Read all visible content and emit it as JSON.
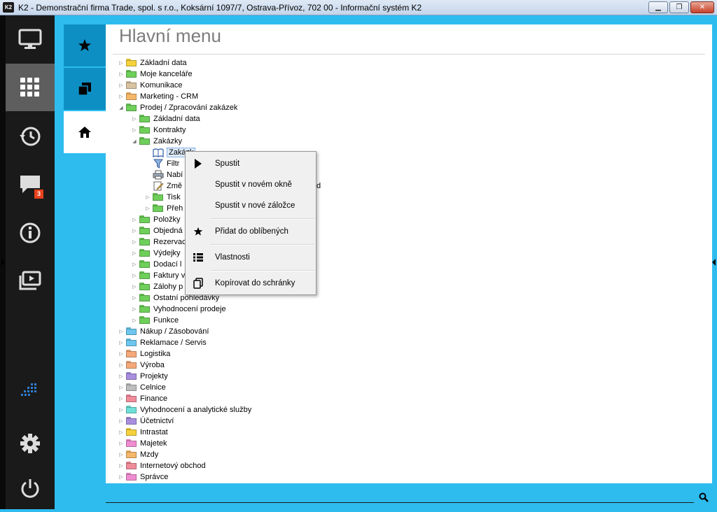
{
  "window": {
    "app_icon_text": "K2",
    "title": "K2 - Demonstrační firma Trade, spol. s r.o., Koksární 1097/7, Ostrava-Přívoz, 702 00 - Informační systém K2",
    "min": "▁",
    "max": "❐",
    "close": "✕"
  },
  "rail": {
    "badge_count": "3"
  },
  "page": {
    "title": "Hlavní menu"
  },
  "tree": [
    {
      "label": "Základní data",
      "level": 0,
      "exp": "▷",
      "color": "#f5d23c"
    },
    {
      "label": "Moje kanceláře",
      "level": 0,
      "exp": "▷",
      "color": "#6ecf5a"
    },
    {
      "label": "Komunikace",
      "level": 0,
      "exp": "▷",
      "color": "#d7c3a1"
    },
    {
      "label": "Marketing - CRM",
      "level": 0,
      "exp": "▷",
      "color": "#f5b76a"
    },
    {
      "label": "Prodej / Zpracování zakázek",
      "level": 0,
      "exp": "◢",
      "color": "#6ecf5a"
    },
    {
      "label": "Základní data",
      "level": 1,
      "exp": "▷",
      "color": "#6ecf5a"
    },
    {
      "label": "Kontrakty",
      "level": 1,
      "exp": "▷",
      "color": "#6ecf5a"
    },
    {
      "label": "Zakázky",
      "level": 1,
      "exp": "◢",
      "color": "#6ecf5a"
    },
    {
      "label": "Zakázk",
      "level": 2,
      "exp": "",
      "icon": "book",
      "selected": true
    },
    {
      "label": "Filtr",
      "level": 2,
      "exp": "",
      "icon": "filter"
    },
    {
      "label": "Nabí",
      "level": 2,
      "exp": "",
      "icon": "printer"
    },
    {
      "label": "Změ",
      "level": 2,
      "exp": "",
      "icon": "edit",
      "suffix": "d"
    },
    {
      "label": "Tisk",
      "level": 2,
      "exp": "▷",
      "color": "#6ecf5a"
    },
    {
      "label": "Přeh",
      "level": 2,
      "exp": "▷",
      "color": "#6ecf5a"
    },
    {
      "label": "Položky",
      "level": 1,
      "exp": "▷",
      "color": "#6ecf5a"
    },
    {
      "label": "Objedná",
      "level": 1,
      "exp": "▷",
      "color": "#6ecf5a"
    },
    {
      "label": "Rezervac",
      "level": 1,
      "exp": "▷",
      "color": "#6ecf5a"
    },
    {
      "label": "Výdejky",
      "level": 1,
      "exp": "▷",
      "color": "#6ecf5a"
    },
    {
      "label": "Dodací l",
      "level": 1,
      "exp": "▷",
      "color": "#6ecf5a"
    },
    {
      "label": "Faktury v",
      "level": 1,
      "exp": "▷",
      "color": "#6ecf5a"
    },
    {
      "label": "Zálohy p",
      "level": 1,
      "exp": "▷",
      "color": "#6ecf5a"
    },
    {
      "label": "Ostatní pohledávky",
      "level": 1,
      "exp": "▷",
      "color": "#6ecf5a"
    },
    {
      "label": "Vyhodnocení prodeje",
      "level": 1,
      "exp": "▷",
      "color": "#6ecf5a"
    },
    {
      "label": "Funkce",
      "level": 1,
      "exp": "▷",
      "color": "#6ecf5a"
    },
    {
      "label": "Nákup / Zásobování",
      "level": 0,
      "exp": "▷",
      "color": "#6cc6ee"
    },
    {
      "label": "Reklamace / Servis",
      "level": 0,
      "exp": "▷",
      "color": "#6cc6ee"
    },
    {
      "label": "Logistika",
      "level": 0,
      "exp": "▷",
      "color": "#f5a97a"
    },
    {
      "label": "Výroba",
      "level": 0,
      "exp": "▷",
      "color": "#f5a97a"
    },
    {
      "label": "Projekty",
      "level": 0,
      "exp": "▷",
      "color": "#a98ee0"
    },
    {
      "label": "Celnice",
      "level": 0,
      "exp": "▷",
      "color": "#bdbdbd"
    },
    {
      "label": "Finance",
      "level": 0,
      "exp": "▷",
      "color": "#f08c9a"
    },
    {
      "label": "Vyhodnocení a analytické služby",
      "level": 0,
      "exp": "▷",
      "color": "#6ee0d8"
    },
    {
      "label": "Účetnictví",
      "level": 0,
      "exp": "▷",
      "color": "#a98ee0"
    },
    {
      "label": "Intrastat",
      "level": 0,
      "exp": "▷",
      "color": "#f5d23c"
    },
    {
      "label": "Majetek",
      "level": 0,
      "exp": "▷",
      "color": "#f08cd0"
    },
    {
      "label": "Mzdy",
      "level": 0,
      "exp": "▷",
      "color": "#f5b76a"
    },
    {
      "label": "Internetový obchod",
      "level": 0,
      "exp": "▷",
      "color": "#f08c9a"
    },
    {
      "label": "Správce",
      "level": 0,
      "exp": "▷",
      "color": "#f08cd0"
    }
  ],
  "context_menu": {
    "run": "Spustit",
    "run_new_window": "Spustit v novém okně",
    "run_new_tab": "Spustit v nové záložce",
    "add_favorites": "Přidat do oblíbených",
    "properties": "Vlastnosti",
    "copy_clipboard": "Kopírovat do schránky"
  }
}
